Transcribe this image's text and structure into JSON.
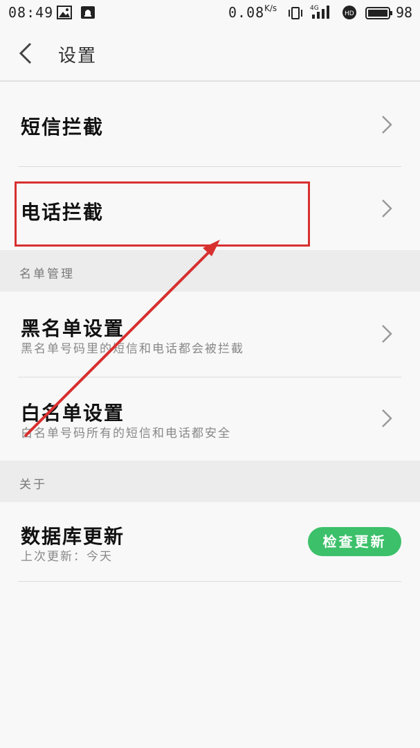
{
  "status_bar": {
    "time": "08:49",
    "speed": "0.08",
    "speed_unit": "K/s",
    "network": "4G",
    "battery": "98"
  },
  "header": {
    "title": "设置"
  },
  "rows": {
    "sms_block": {
      "label": "短信拦截"
    },
    "call_block": {
      "label": "电话拦截"
    }
  },
  "sections": {
    "list_mgmt": {
      "label": "名单管理"
    },
    "about": {
      "label": "关于"
    }
  },
  "blacklist": {
    "label": "黑名单设置",
    "desc": "黑名单号码里的短信和电话都会被拦截"
  },
  "whitelist": {
    "label": "白名单设置",
    "desc": "白名单号码所有的短信和电话都安全"
  },
  "database": {
    "label": "数据库更新",
    "last_update": "上次更新：今天",
    "button": "检查更新"
  },
  "colors": {
    "accent_green": "#3cc06a",
    "annotation_red": "#d7302f"
  }
}
